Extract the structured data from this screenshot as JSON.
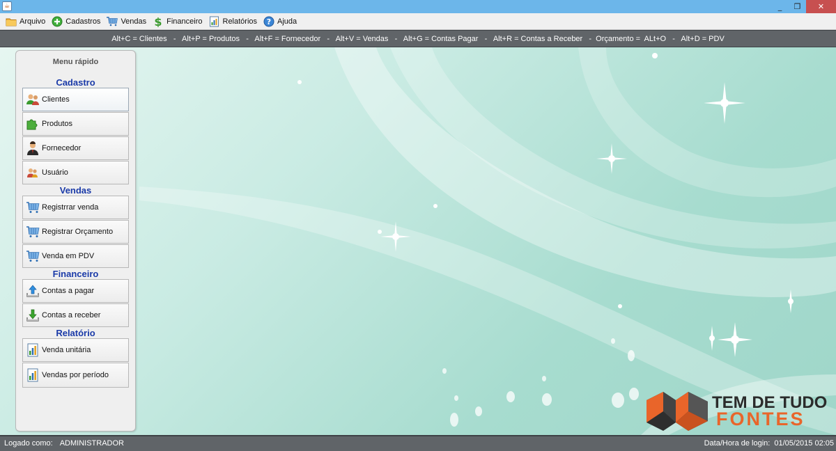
{
  "window": {
    "icon": "java-icon",
    "controls": {
      "minimize": "_",
      "restore": "❐",
      "close": "✕"
    }
  },
  "menubar": {
    "items": [
      {
        "label": "Arquivo",
        "icon": "folder-icon"
      },
      {
        "label": "Cadastros",
        "icon": "plus-circle-icon"
      },
      {
        "label": "Vendas",
        "icon": "cart-icon"
      },
      {
        "label": "Financeiro",
        "icon": "dollar-icon"
      },
      {
        "label": "Relatórios",
        "icon": "report-icon"
      },
      {
        "label": "Ajuda",
        "icon": "help-icon"
      }
    ]
  },
  "shortcuts": "Alt+C = Clientes   -   Alt+P = Produtos   -   Alt+F = Fornecedor   -   Alt+V = Vendas   -   Alt+G = Contas Pagar   -   Alt+R = Contas a Receber   -  Orçamento =  ALt+O   -   Alt+D = PDV",
  "sidebar": {
    "title": "Menu rápido",
    "sections": {
      "cadastro": "Cadastro",
      "vendas": "Vendas",
      "financeiro": "Financeiro",
      "relatorio": "Relatório"
    },
    "buttons": {
      "clientes": "Clientes",
      "produtos": "Produtos",
      "fornecedor": "Fornecedor",
      "usuario": "Usuário",
      "registrar_venda": "Registrrar venda",
      "registrar_orcamento": "Registrar Orçamento",
      "venda_pdv": "Venda em PDV",
      "contas_pagar": "Contas a pagar",
      "contas_receber": "Contas a receber",
      "venda_unitaria": "Venda unitária",
      "vendas_periodo": "Vendas por período"
    }
  },
  "logo": {
    "line1": "TEM DE TUDO",
    "line2": "FONTES"
  },
  "status": {
    "logged_label": "Logado como:",
    "user": "ADMINISTRADOR",
    "login_label": "Data/Hora de login:",
    "login_datetime": "01/05/2015 02:05"
  },
  "colors": {
    "titlebar": "#6cb6ea",
    "section_heading": "#1a3aa8",
    "close_button": "#c75050",
    "logo_orange": "#e9652a"
  }
}
